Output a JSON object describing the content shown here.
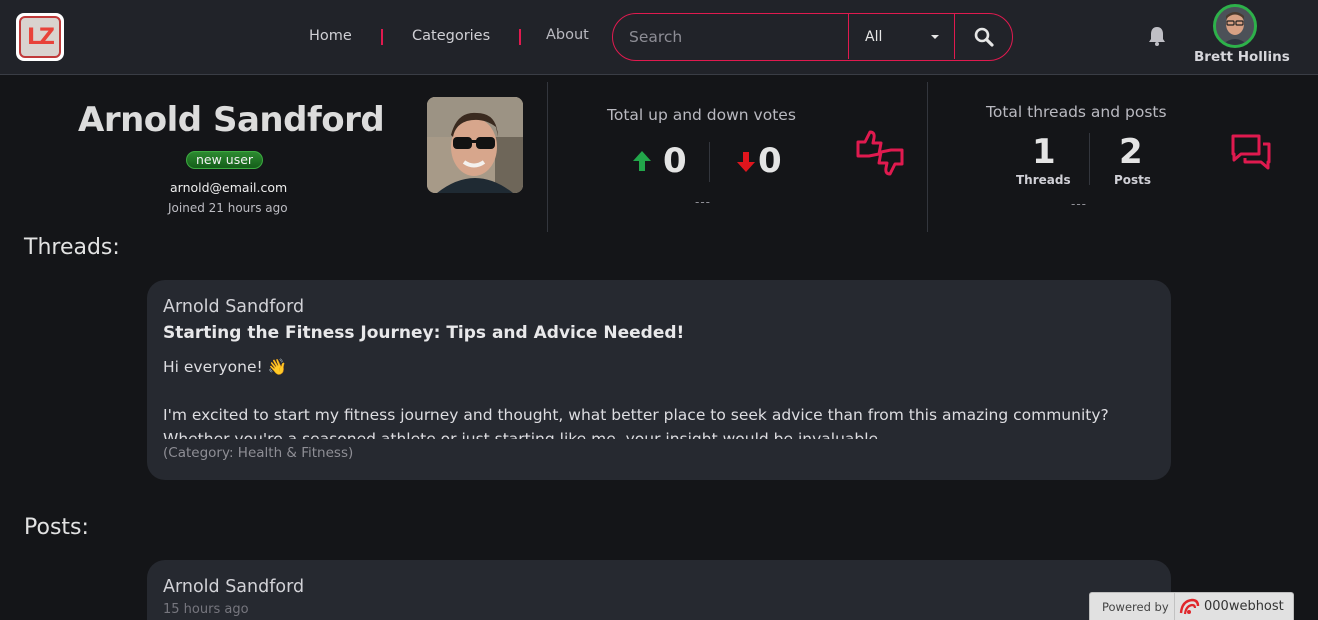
{
  "header": {
    "logo_text": "LZ",
    "nav": {
      "home": "Home",
      "categories": "Categories",
      "about": "About"
    },
    "search": {
      "placeholder": "Search",
      "category_selected": "All"
    },
    "user": {
      "name": "Brett Hollins"
    }
  },
  "profile": {
    "name": "Arnold Sandford",
    "badge": "new user",
    "email": "arnold@email.com",
    "joined": "Joined 21 hours ago"
  },
  "votes": {
    "title": "Total up and down votes",
    "up": "0",
    "down": "0",
    "placeholder": "---"
  },
  "activity": {
    "title": "Total threads and posts",
    "threads_count": "1",
    "threads_label": "Threads",
    "posts_count": "2",
    "posts_label": "Posts",
    "placeholder": "---"
  },
  "sections": {
    "threads": "Threads:",
    "posts": "Posts:"
  },
  "thread_card": {
    "author": "Arnold Sandford",
    "title": "Starting the Fitness Journey: Tips and Advice Needed!",
    "line1": "Hi everyone! 👋",
    "line2": "I'm excited to start my fitness journey and thought, what better place to seek advice than from this amazing community?",
    "line3": "Whether you're a seasoned athlete or just starting like me, your insight would be invaluable.",
    "category": "(Category: Health & Fitness)"
  },
  "post_card": {
    "author": "Arnold Sandford",
    "time": "15 hours ago"
  },
  "footer_badge": {
    "powered_by": "Powered by",
    "host": "000webhost"
  },
  "colors": {
    "accent": "#e01a4f",
    "up": "#22a64a",
    "down": "#e0151d",
    "badge": "#2c8a30"
  }
}
